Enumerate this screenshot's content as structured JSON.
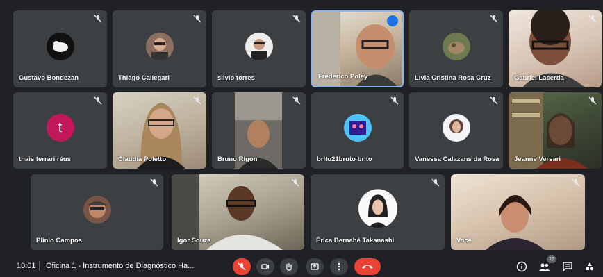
{
  "participants": [
    {
      "name": "Gustavo Bondezan"
    },
    {
      "name": "Thiago Callegari"
    },
    {
      "name": "silvio torres"
    },
    {
      "name": "Frederico Poley"
    },
    {
      "name": "Livia Cristina Rosa Cruz"
    },
    {
      "name": "Gabriel Lacerda"
    },
    {
      "name": "thais ferrari réus",
      "initial": "t"
    },
    {
      "name": "Claudia Poletto"
    },
    {
      "name": "Bruno Rigon"
    },
    {
      "name": "brito21bruto brito"
    },
    {
      "name": "Vanessa Calazans da Rosa"
    },
    {
      "name": "Jeanne Versari"
    },
    {
      "name": "Plinio Campos"
    },
    {
      "name": "Igor Souza"
    },
    {
      "name": "Érica Bernabé Takanashi"
    },
    {
      "name": "Você"
    }
  ],
  "meeting": {
    "time": "10:01",
    "title": "Oficina 1 - Instrumento de Diagnóstico Ha..."
  },
  "people_count": "16",
  "colors": {
    "background": "#202124",
    "tile": "#3c4043",
    "accent": "#8ab4f8",
    "danger": "#ea4335"
  },
  "icons": [
    "mic-off-icon",
    "camera-icon",
    "raise-hand-icon",
    "present-icon",
    "more-icon",
    "end-call-icon",
    "info-icon",
    "people-icon",
    "chat-icon",
    "activities-icon"
  ]
}
